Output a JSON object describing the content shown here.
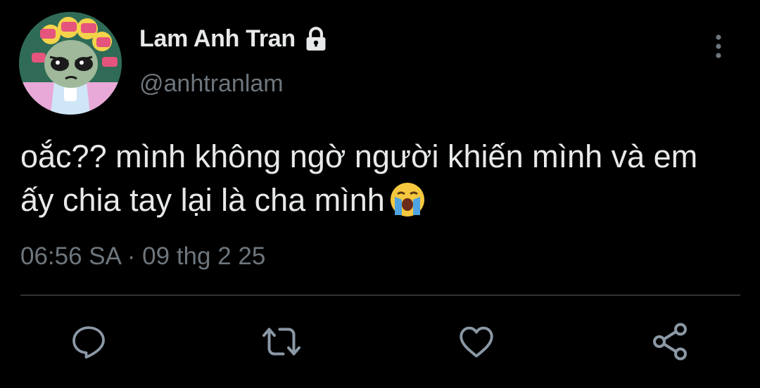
{
  "author": {
    "name": "Lam Anh Tran",
    "handle": "@anhtranlam",
    "protected_icon": "lock-icon",
    "avatar": "cartoon-avatar"
  },
  "tweet": {
    "text": "oắc?? mình không ngờ người khiến mình và em ấy chia tay lại là cha mình",
    "emoji": "loudly-crying-face",
    "timestamp": "06:56 SA · 09 thg 2 25"
  },
  "actions": {
    "reply": "reply-icon",
    "retweet": "retweet-icon",
    "like": "heart-icon",
    "share": "share-icon",
    "more": "more-vertical-icon"
  },
  "colors": {
    "background": "#000000",
    "primary_text": "#e7e9ea",
    "secondary_text": "#6e767d",
    "icon": "#8b98a5",
    "divider": "#2f3336"
  }
}
